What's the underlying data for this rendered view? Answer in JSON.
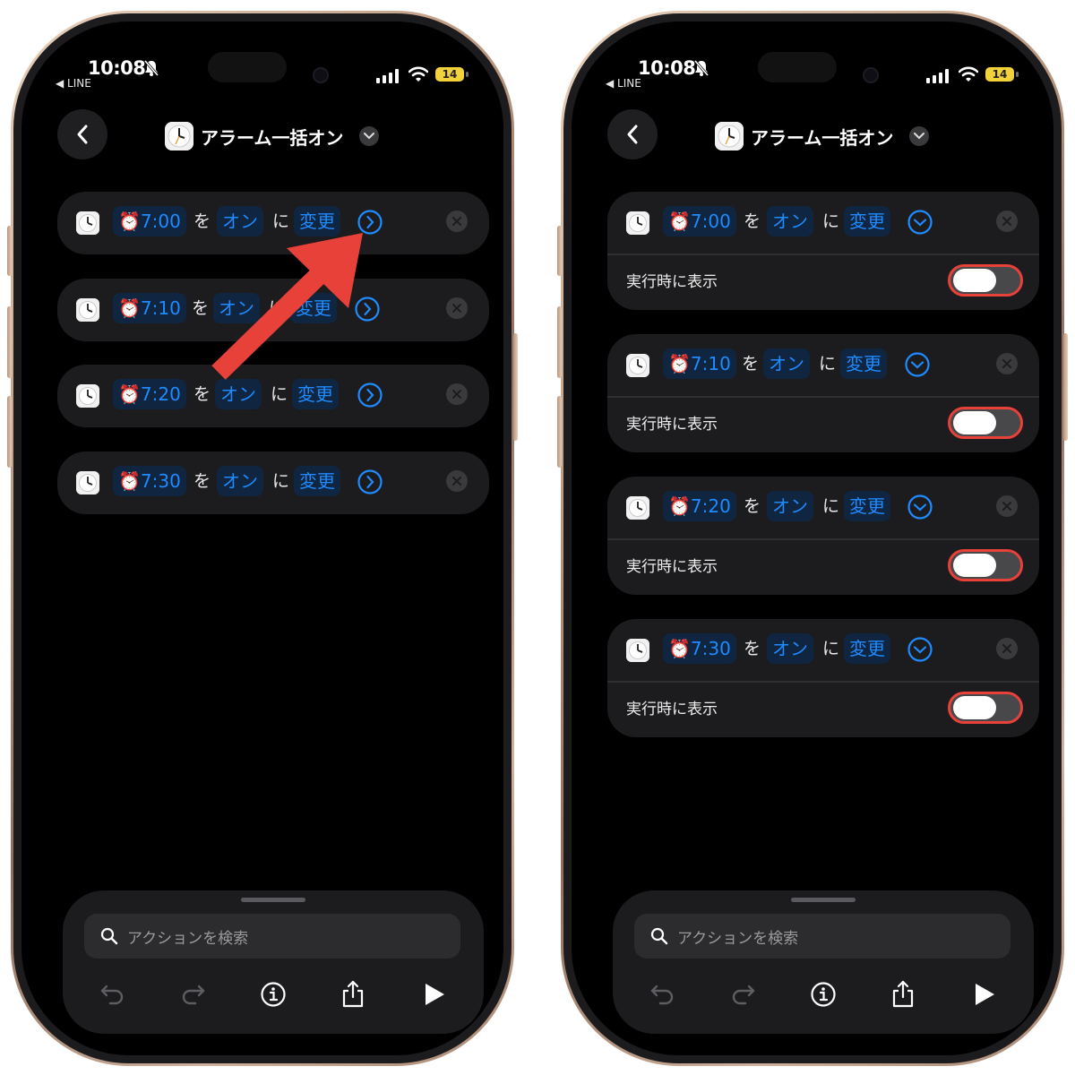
{
  "status_bar": {
    "time": "10:08",
    "back_app": "◀ LINE",
    "battery": "14"
  },
  "nav": {
    "title": "アラーム一括オン"
  },
  "actions": [
    {
      "time": "7:00",
      "state": "オン",
      "verb": "変更"
    },
    {
      "time": "7:10",
      "state": "オン",
      "verb": "変更"
    },
    {
      "time": "7:20",
      "state": "オン",
      "verb": "変更"
    },
    {
      "time": "7:30",
      "state": "オン",
      "verb": "変更"
    }
  ],
  "particles": {
    "wo": "を",
    "ni": "に"
  },
  "alarm_emoji": "⏰",
  "expanded": {
    "show_when_run_label": "実行時に表示",
    "toggle_on": false
  },
  "search": {
    "placeholder": "アクションを検索"
  },
  "colors": {
    "accent": "#1f8bff",
    "token_bg": "#0f2540",
    "card_bg": "#1c1c1e",
    "annotation": "#e8413a",
    "frame": "#c9a78e"
  },
  "icons": [
    "back-chevron-icon",
    "dropdown-chevron-icon",
    "clock-app-icon",
    "chevron-right-circle-icon",
    "chevron-down-circle-icon",
    "close-icon",
    "search-icon",
    "undo-icon",
    "redo-icon",
    "info-icon",
    "share-icon",
    "play-icon"
  ]
}
